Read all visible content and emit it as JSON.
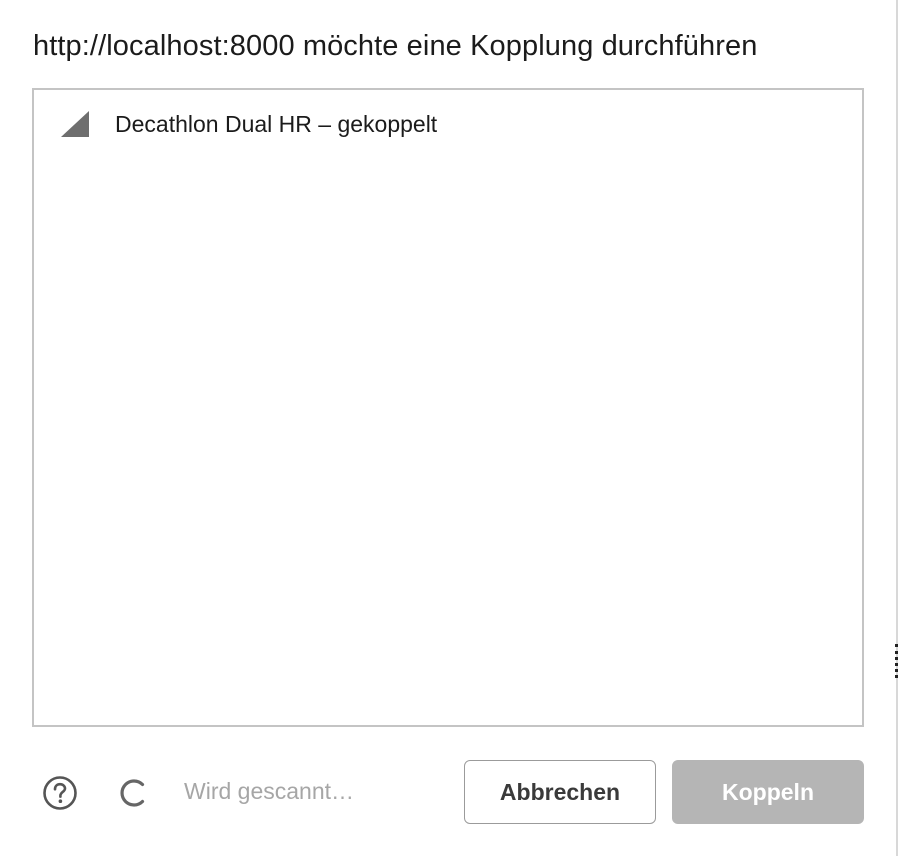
{
  "dialog": {
    "title": "http://localhost:8000 möchte eine Kopplung durchführen"
  },
  "devices": [
    {
      "label": "Decathlon Dual HR – gekoppelt",
      "icon": "signal-strength-icon"
    }
  ],
  "footer": {
    "help_icon": "help-icon",
    "spinner_icon": "spinner-icon",
    "status": "Wird gescannt…",
    "cancel_label": "Abbrechen",
    "pair_label": "Koppeln"
  },
  "colors": {
    "title_text": "#1b1b1b",
    "status_text": "#a6a6a6",
    "list_border": "#c4c4c4",
    "pair_button_disabled": "#b5b5b5",
    "cancel_border": "#9b9b9b"
  }
}
